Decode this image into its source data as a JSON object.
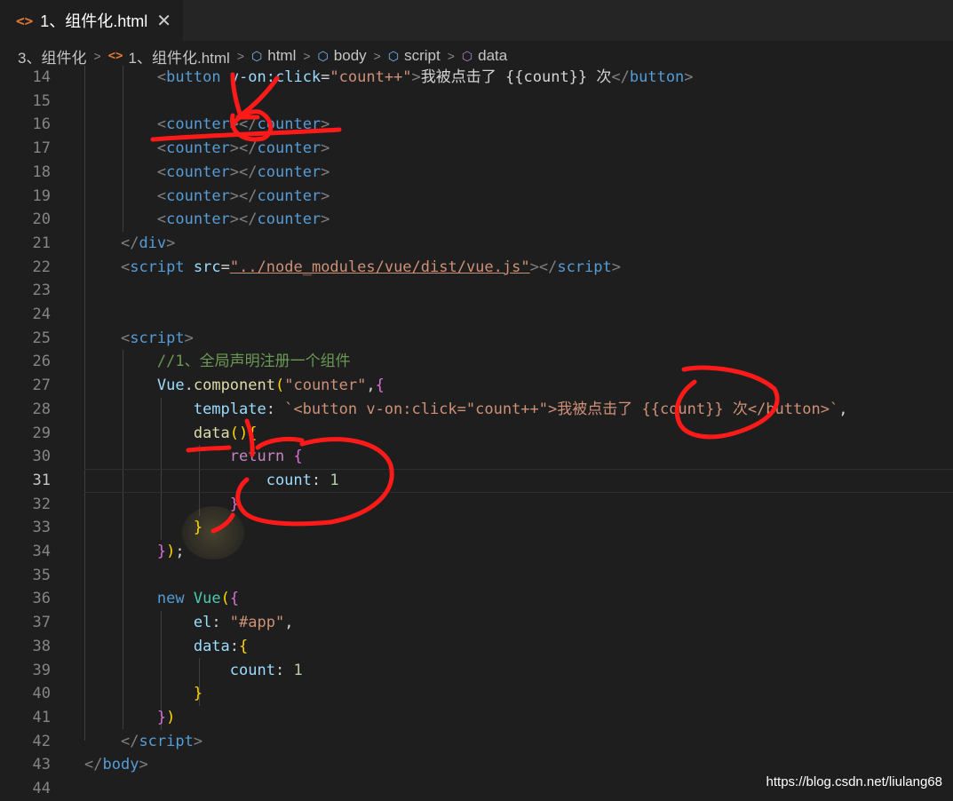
{
  "tab": {
    "icon": "<>",
    "label": "1、组件化.html",
    "close": "✕"
  },
  "breadcrumb": [
    "3、组件化",
    "1、组件化.html",
    "html",
    "body",
    "script",
    "data"
  ],
  "lines": [
    {
      "n": "14"
    },
    {
      "n": "15"
    },
    {
      "n": "16"
    },
    {
      "n": "17"
    },
    {
      "n": "18"
    },
    {
      "n": "19"
    },
    {
      "n": "20"
    },
    {
      "n": "21"
    },
    {
      "n": "22"
    },
    {
      "n": "23"
    },
    {
      "n": "24"
    },
    {
      "n": "25"
    },
    {
      "n": "26"
    },
    {
      "n": "27"
    },
    {
      "n": "28"
    },
    {
      "n": "29"
    },
    {
      "n": "30"
    },
    {
      "n": "31"
    },
    {
      "n": "32"
    },
    {
      "n": "33"
    },
    {
      "n": "34"
    },
    {
      "n": "35"
    },
    {
      "n": "36"
    },
    {
      "n": "37"
    },
    {
      "n": "38"
    },
    {
      "n": "39"
    },
    {
      "n": "40"
    },
    {
      "n": "41"
    },
    {
      "n": "42"
    },
    {
      "n": "43"
    },
    {
      "n": "44"
    }
  ],
  "code": {
    "l14": {
      "button_open": "button",
      "attr": "v-on:click",
      "val": "\"count++\"",
      "text": "我被点击了 {{count}} 次",
      "close": "button"
    },
    "counter": "counter",
    "l21": "div",
    "l22": {
      "tag": "script",
      "attr": "src",
      "val": "\"../node_modules/vue/dist/vue.js\""
    },
    "l25": "script",
    "l26": "//1、全局声明注册一个组件",
    "l27": {
      "obj": "Vue",
      "method": "component",
      "str": "\"counter\""
    },
    "l28": {
      "key": "template",
      "str": "`<button v-on:click=\"count++\">我被点击了 {{count}} 次</button>`"
    },
    "l29": "data",
    "l30": "return",
    "l31": {
      "key": "count",
      "val": "1"
    },
    "l36": {
      "kw": "new",
      "cls": "Vue"
    },
    "l37": {
      "key": "el",
      "val": "\"#app\""
    },
    "l38": "data",
    "l39": {
      "key": "count",
      "val": "1"
    },
    "l42": "script",
    "l43": "body"
  },
  "watermark": "https://blog.csdn.net/liulang68",
  "colors": {
    "annotation": "#ff0000",
    "active_line": "#c6c6c6"
  }
}
